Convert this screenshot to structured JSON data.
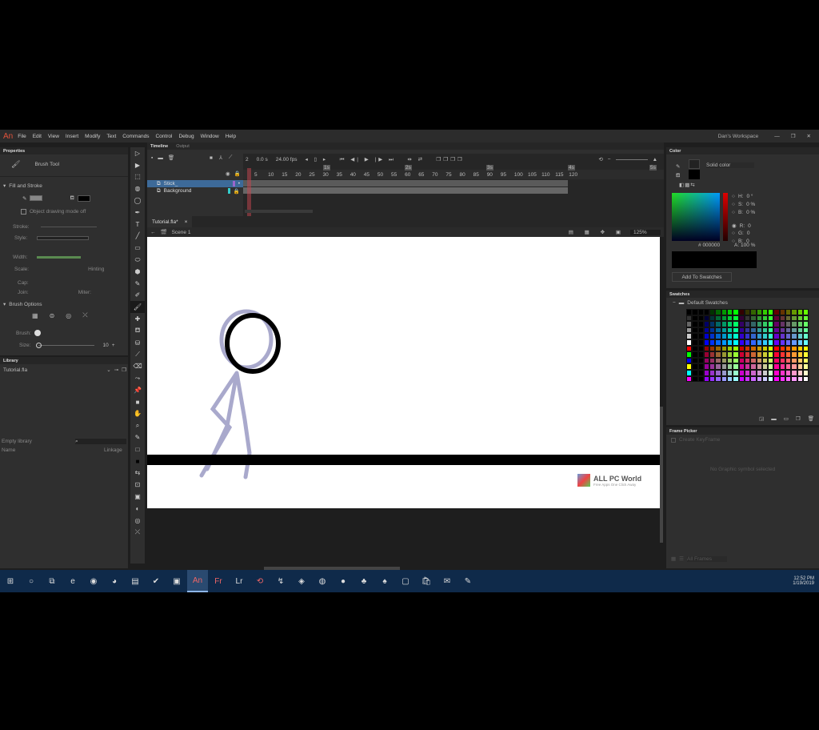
{
  "app": {
    "logo": "An",
    "menu": [
      "File",
      "Edit",
      "View",
      "Insert",
      "Modify",
      "Text",
      "Commands",
      "Control",
      "Debug",
      "Window",
      "Help"
    ],
    "workspace": "Dan's Workspace"
  },
  "properties": {
    "title": "Properties",
    "tool": "Brush Tool",
    "fill_stroke": "Fill and Stroke",
    "object_mode": "Object drawing mode off",
    "stroke_label": "Stroke:",
    "style_label": "Style:",
    "width_label": "Width:",
    "scale_label": "Scale:",
    "hinting": "Hinting",
    "cap_label": "Cap:",
    "join_label": "Join:",
    "miter_label": "Miter:",
    "brush_options": "Brush Options",
    "brush_label": "Brush:",
    "size_label": "Size:",
    "size_value": "10",
    "fill_color": "#000000"
  },
  "library": {
    "title": "Library",
    "file": "Tutorial.fla",
    "count": "Empty library",
    "col_name": "Name",
    "col_linkage": "Linkage"
  },
  "timeline": {
    "tabs": [
      "Timeline",
      "Output"
    ],
    "frame": "2",
    "time": "0.0 s",
    "fps": "24.00 fps",
    "layers": [
      {
        "name": "Stick_",
        "selected": true
      },
      {
        "name": "Background",
        "selected": false
      }
    ],
    "ticks": [
      "5",
      "10",
      "15",
      "20",
      "25",
      "30",
      "35",
      "40",
      "45",
      "50",
      "55",
      "60",
      "65",
      "70",
      "75",
      "80",
      "85",
      "90",
      "95",
      "100",
      "105",
      "110",
      "115",
      "120"
    ],
    "markers": [
      "1s",
      "2s",
      "3s",
      "4s",
      "5s"
    ]
  },
  "document": {
    "tab": "Tutorial.fla*",
    "scene": "Scene 1",
    "zoom": "125%"
  },
  "color": {
    "title": "Color",
    "type": "Solid color",
    "h": "0 °",
    "s": "0 %",
    "b": "0 %",
    "r": "0",
    "g": "0",
    "bl": "0",
    "hex": "000000",
    "alpha": "100 %",
    "add": "Add To Swatches",
    "labels": {
      "h": "H:",
      "s": "S:",
      "b": "B:",
      "r": "R:",
      "g": "G:",
      "bl": "B:",
      "hex": "#",
      "a": "A:"
    }
  },
  "swatches": {
    "title": "Swatches",
    "group": "Default Swatches"
  },
  "frame_picker": {
    "title": "Frame Picker",
    "create_keyframe": "Create KeyFrame",
    "empty": "No Graphic symbol selected",
    "frames": "All Frames"
  },
  "watermark": {
    "title": "ALL PC World",
    "subtitle": "Free Apps One Click Away"
  },
  "taskbar": {
    "icons": [
      "windows-start",
      "cortana",
      "task-view",
      "edge",
      "obs",
      "chrome",
      "file-explorer",
      "steam",
      "media",
      "animate",
      "fresco",
      "photoshop-lightroom",
      "acrobat",
      "tool",
      "paint",
      "app-a",
      "app-b",
      "app-c",
      "app-d",
      "app-e",
      "store",
      "mail",
      "sketch"
    ],
    "active": "animate",
    "time": "12:52 PM",
    "date": "1/19/2019"
  }
}
